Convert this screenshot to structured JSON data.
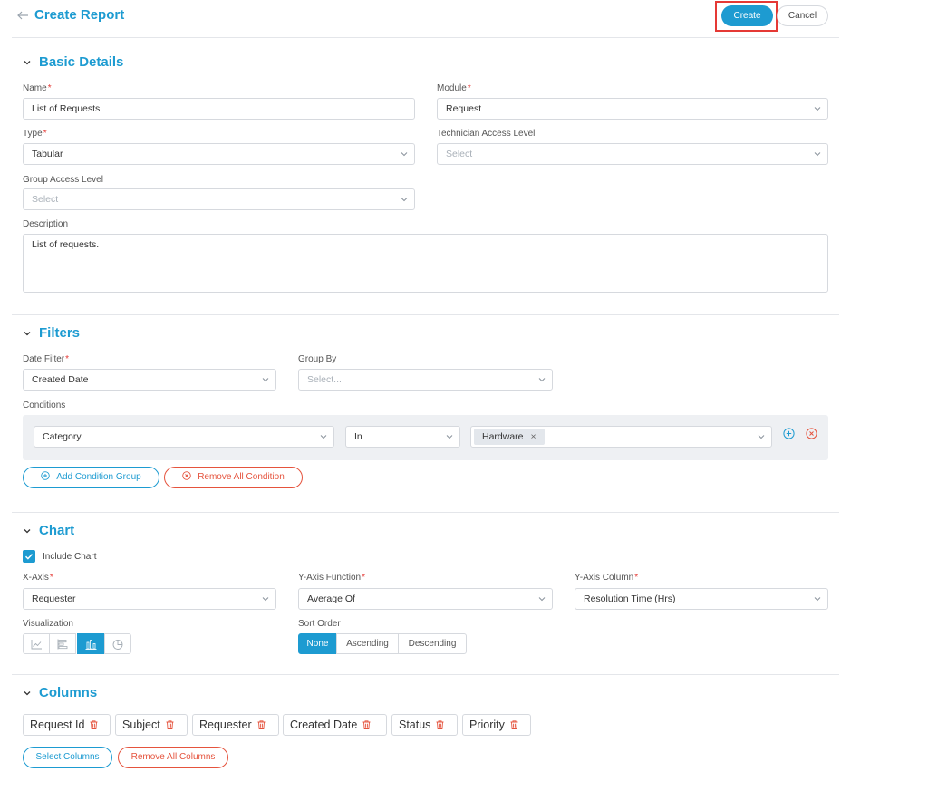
{
  "header": {
    "title": "Create Report",
    "create_label": "Create",
    "cancel_label": "Cancel"
  },
  "basic": {
    "title": "Basic Details",
    "name_label": "Name",
    "name_value": "List of Requests",
    "module_label": "Module",
    "module_value": "Request",
    "type_label": "Type",
    "type_value": "Tabular",
    "tech_label": "Technician Access Level",
    "tech_placeholder": "Select",
    "group_label": "Group Access Level",
    "group_placeholder": "Select",
    "desc_label": "Description",
    "desc_value": "List of requests."
  },
  "filters": {
    "title": "Filters",
    "date_label": "Date Filter",
    "date_value": "Created Date",
    "groupby_label": "Group By",
    "groupby_placeholder": "Select...",
    "conditions_label": "Conditions",
    "cond_field": "Category",
    "cond_op": "In",
    "cond_value_chip": "Hardware",
    "chip_remove": "×",
    "add_group_label": "Add Condition Group",
    "remove_all_label": "Remove All Condition"
  },
  "chart": {
    "title": "Chart",
    "include_label": "Include Chart",
    "xaxis_label": "X-Axis",
    "xaxis_value": "Requester",
    "yfunc_label": "Y-Axis Function",
    "yfunc_value": "Average Of",
    "ycol_label": "Y-Axis Column",
    "ycol_value": "Resolution Time (Hrs)",
    "viz_label": "Visualization",
    "sort_label": "Sort Order",
    "sort_none": "None",
    "sort_asc": "Ascending",
    "sort_desc": "Descending"
  },
  "columns": {
    "title": "Columns",
    "items": [
      "Request Id",
      "Subject",
      "Requester",
      "Created Date",
      "Status",
      "Priority"
    ],
    "select_label": "Select Columns",
    "remove_all_label": "Remove All Columns"
  },
  "colors": {
    "accent": "#1d9bd1",
    "danger": "#e5533d",
    "highlight_box": "#e53935"
  }
}
